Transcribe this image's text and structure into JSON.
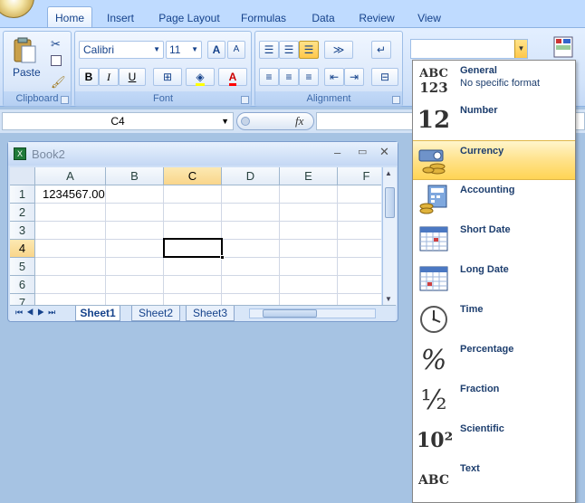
{
  "tabs": [
    "Home",
    "Insert",
    "Page Layout",
    "Formulas",
    "Data",
    "Review",
    "View"
  ],
  "groups": {
    "clipboard": "Clipboard",
    "font": "Font",
    "alignment": "Alignment"
  },
  "clipboard": {
    "paste_label": "Paste"
  },
  "font": {
    "name": "Calibri",
    "size": "11",
    "bold": "B",
    "italic": "I",
    "underline": "U",
    "grow": "A",
    "shrink": "A",
    "color_a": "A"
  },
  "name_box": "C4",
  "fx": "fx",
  "workbook": {
    "title": "Book2",
    "columns": [
      "A",
      "B",
      "C",
      "D",
      "E",
      "F"
    ],
    "rows": [
      "1",
      "2",
      "3",
      "4",
      "5",
      "6",
      "7"
    ],
    "cells": {
      "A1": "1234567.00"
    },
    "sheets": [
      "Sheet1",
      "Sheet2",
      "Sheet3"
    ]
  },
  "number_formats": [
    {
      "name": "General",
      "sub": "No specific format",
      "icon": "abc-123-icon",
      "glyph": "ABC\n123"
    },
    {
      "name": "Number",
      "sub": "",
      "icon": "number-12-icon",
      "glyph": "12"
    },
    {
      "name": "Currency",
      "sub": "",
      "icon": "currency-icon",
      "glyph": ""
    },
    {
      "name": "Accounting",
      "sub": "",
      "icon": "accounting-icon",
      "glyph": ""
    },
    {
      "name": "Short Date",
      "sub": "",
      "icon": "calendar-icon",
      "glyph": ""
    },
    {
      "name": "Long Date",
      "sub": "",
      "icon": "calendar-icon",
      "glyph": ""
    },
    {
      "name": "Time",
      "sub": "",
      "icon": "clock-icon",
      "glyph": ""
    },
    {
      "name": "Percentage",
      "sub": "",
      "icon": "percent-icon",
      "glyph": "%"
    },
    {
      "name": "Fraction",
      "sub": "",
      "icon": "fraction-icon",
      "glyph": "½"
    },
    {
      "name": "Scientific",
      "sub": "",
      "icon": "scientific-icon",
      "glyph": "10²"
    },
    {
      "name": "Text",
      "sub": "",
      "icon": "abc-text-icon",
      "glyph": "ABC"
    }
  ],
  "highlighted_format": "Currency",
  "colors": {
    "ribbon": "#d2e3fa",
    "highlight": "#ffd454",
    "accent": "#15428b"
  }
}
